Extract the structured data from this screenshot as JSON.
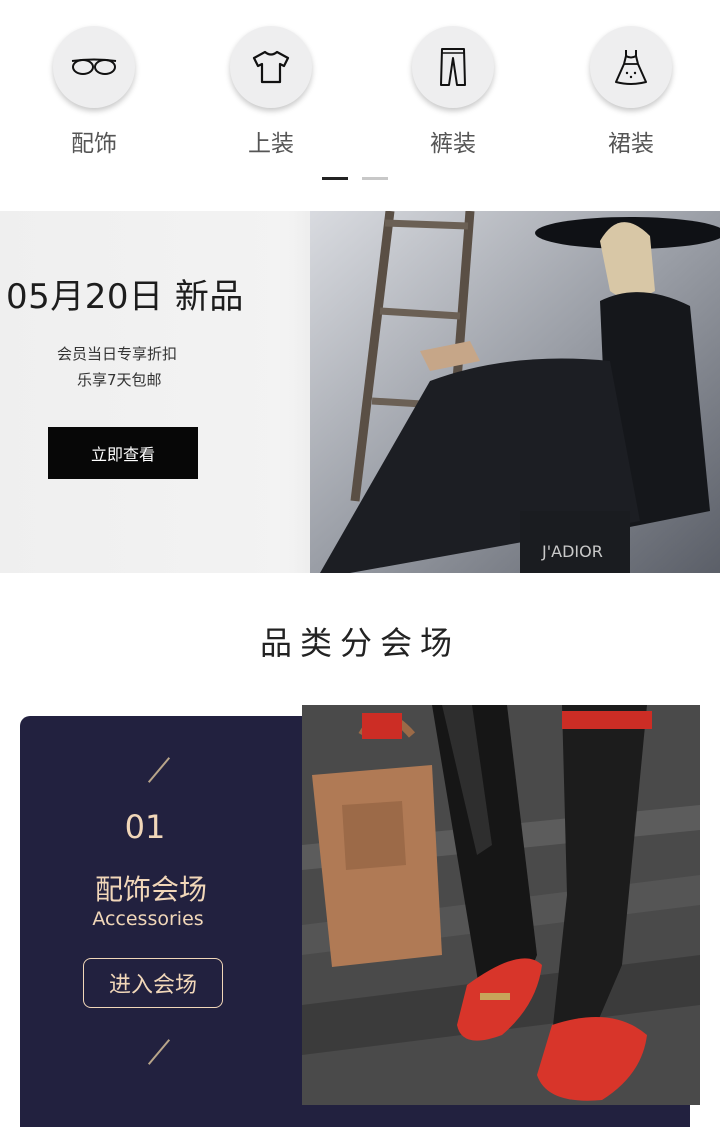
{
  "categories": [
    {
      "label": "配饰",
      "icon": "glasses-icon"
    },
    {
      "label": "上装",
      "icon": "tshirt-icon"
    },
    {
      "label": "裤装",
      "icon": "pants-icon"
    },
    {
      "label": "裙装",
      "icon": "dress-icon"
    }
  ],
  "pager": {
    "active_index": 0,
    "count": 2
  },
  "banner": {
    "headline": "05月20日 新品",
    "line1": "会员当日专享折扣",
    "line2": "乐享7天包邮",
    "button": "立即查看"
  },
  "section": {
    "title": "品类分会场"
  },
  "venue": {
    "number": "01",
    "title_cn": "配饰会场",
    "title_en": "Accessories",
    "enter_label": "进入会场"
  },
  "colors": {
    "card_bg": "#22213f",
    "card_accent": "#f1d7b9",
    "pager_active": "#222222",
    "pager_inactive": "#c8c8c8"
  }
}
